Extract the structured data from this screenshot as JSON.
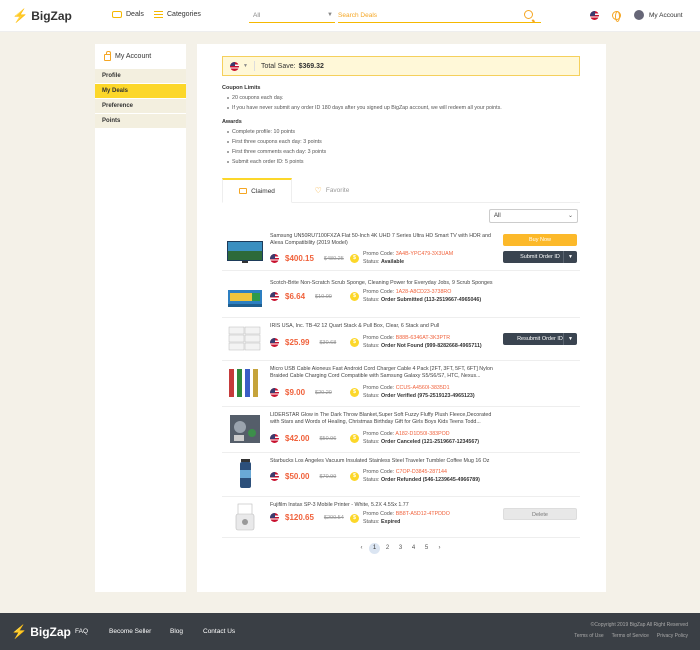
{
  "header": {
    "brand": "BigZap",
    "deals": "Deals",
    "categories": "Categories",
    "search_select": "All",
    "search_placeholder": "Search Deals",
    "account": "My Account"
  },
  "sidebar": {
    "title": "My Account",
    "items": [
      "Profile",
      "My Deals",
      "Preference",
      "Points"
    ]
  },
  "summary": {
    "label": "Total Save:",
    "amount": "$369.32"
  },
  "coupon_limits": {
    "title": "Coupon Limits",
    "rules": [
      "20 coupons each day.",
      "If you have never submit any order ID 180 days after you signed up BigZap account, we will redeem all your points."
    ]
  },
  "awards": {
    "title": "Awards",
    "rules": [
      "Complete profile: 10 points",
      "First three coupons each day: 3 points",
      "First three comments each day: 3 points",
      "Submit each order ID: 5 points"
    ]
  },
  "tabs": {
    "claimed": "Claimed",
    "favorite": "Favorite"
  },
  "filter": "All",
  "labels": {
    "promo": "Promo Code:",
    "status": "Status:"
  },
  "deals": [
    {
      "name": "Samsung UN50RU7100FXZA Flat 50-Inch 4K UHD 7 Series Ultra HD Smart TV with HDR and Alexa Compatibility (2019 Model)",
      "price": "$400.15",
      "old": "$480.25",
      "code": "3A4B-YPC479-3X3UAM",
      "status": "Available",
      "button": "Buy Now",
      "button2": "Submit Order ID"
    },
    {
      "name": "Scotch-Brite Non-Scratch Scrub Sponge, Cleaning Power for Everyday Jobs, 9 Scrub Sponges",
      "price": "$6.64",
      "old": "$10.00",
      "code": "1A28-A8CD23-3738RO",
      "status": "Order Submitted (113-2519667-4965046)"
    },
    {
      "name": "IRIS USA, Inc. TB-42 12 Quart Stack & Pull Box, Clear, 6 Stack and Pull",
      "price": "$25.99",
      "old": "$30.68",
      "code": "B88B-6346AT-3K3PTR",
      "status": "Order Not Found (999-8282668-4965711)",
      "button": "Resubmit Order ID"
    },
    {
      "name": "Micro USB Cable Aioneus Fast Android Cord Charger Cable 4 Pack [2FT, 3FT, 5FT, 6FT] Nylon Braided Cable Charging Cord Compatible with Samsung Galaxy S5/S6/S7, HTC, Nexus...",
      "price": "$9.00",
      "old": "$20.20",
      "code": "CCUS-A4560I-3835D1",
      "status": "Order Verified (975-2519123-4965123)"
    },
    {
      "name": "LIDERSTAR Glow in The Dark Throw Blanket,Super Soft Fuzzy Fluffy Plush Fleece,Decorated with Stars and Words of Healing, Christmas Birthday Gift for Girls Boys Kids Teens Todd...",
      "price": "$42.00",
      "old": "$50.96",
      "code": "A182-D1D50I-383POD",
      "status": "Order Canceled (121-2519667-1234567)"
    },
    {
      "name": "Starbucks Los Angeles Vacuum Insulated Stainless Steel Traveler Tumbler Coffee Mug 16 Oz",
      "price": "$50.00",
      "old": "$70.99",
      "code": "C7OP-D3845-287144",
      "status": "Order Refunded (546-1239645-4966789)"
    },
    {
      "name": "Fujifilm Instax SP-3 Mobile Printer - White, 5.2X 4.5Sx 1.77",
      "price": "$120.65",
      "old": "$200.54",
      "code": "BB8T-A5D12-4TPDDO",
      "status": "Expired",
      "button": "Delete"
    }
  ],
  "pagination": [
    "1",
    "2",
    "3",
    "4",
    "5"
  ],
  "footer": {
    "brand": "BigZap",
    "links": [
      "FAQ",
      "Become Seller",
      "Blog",
      "Contact Us"
    ],
    "copyright": "©Copyright 2019 BigZap All Right Reserved",
    "legal": [
      "Terms of Use",
      "Terms of Service",
      "Privacy Policy"
    ]
  },
  "colors": {
    "accent": "#fcd72a",
    "price": "#f0623c",
    "footer": "#3a3f45",
    "button_dark": "#3a4450"
  }
}
